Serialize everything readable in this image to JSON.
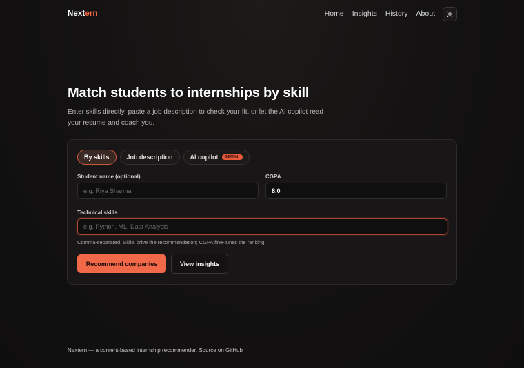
{
  "brand": {
    "part1": "Next",
    "part2": "ern",
    "accent_color": "#ff6a43"
  },
  "nav": {
    "links": [
      "Home",
      "Insights",
      "History",
      "About"
    ],
    "theme_toggle_icon": "sun-icon"
  },
  "hero": {
    "title": "Match students to internships by skill",
    "subtitle": "Enter skills directly, paste a job description to check your fit, or let the AI copilot read your resume and coach you."
  },
  "tabs": [
    {
      "label": "By skills",
      "active": true
    },
    {
      "label": "Job description",
      "active": false
    },
    {
      "label": "AI copilot",
      "badge": "GEMINI",
      "active": false
    }
  ],
  "form": {
    "name_label": "Student name (optional)",
    "name_placeholder": "e.g. Riya Sharma",
    "cgpa_label": "CGPA",
    "cgpa_value": "8.0",
    "skills_label": "Technical skills",
    "skills_placeholder": "e.g. Python, ML, Data Analysis",
    "skills_hint": "Comma-separated. Skills drive the recommendation; CGPA fine-tunes the ranking."
  },
  "actions": {
    "primary": "Recommend companies",
    "secondary": "View insights"
  },
  "footer": {
    "text": "Nextern — a content-based internship recommender. Source on ",
    "link": "GitHub"
  }
}
